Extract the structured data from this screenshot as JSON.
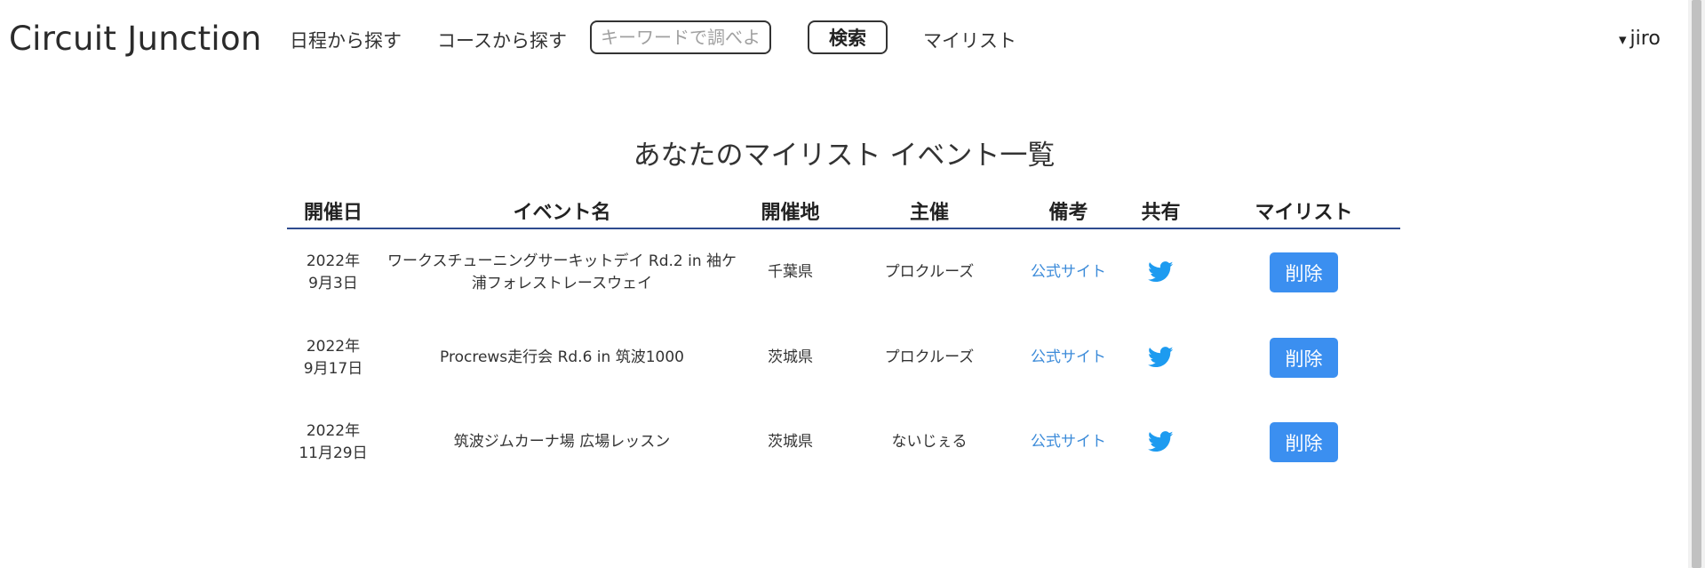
{
  "header": {
    "brand": "Circuit Junction",
    "nav_schedule": "日程から探す",
    "nav_course": "コースから探す",
    "search_placeholder": "キーワードで調べよう！",
    "search_button": "検索",
    "nav_mylist": "マイリスト",
    "user_caret": "▾",
    "user_name": "jiro"
  },
  "page": {
    "title": "あなたのマイリスト イベント一覧"
  },
  "table": {
    "columns": [
      "開催日",
      "イベント名",
      "開催地",
      "主催",
      "備考",
      "共有",
      "マイリスト"
    ],
    "rows": [
      {
        "date_year": "2022年",
        "date_day": "9月3日",
        "name": "ワークスチューニングサーキットデイ Rd.2 in 袖ケ浦フォレストレースウェイ",
        "location": "千葉県",
        "organizer": "プロクルーズ",
        "note_link": "公式サイト",
        "share_icon": "twitter-icon",
        "action": "削除"
      },
      {
        "date_year": "2022年",
        "date_day": "9月17日",
        "name": "Procrews走行会 Rd.6 in 筑波1000",
        "location": "茨城県",
        "organizer": "プロクルーズ",
        "note_link": "公式サイト",
        "share_icon": "twitter-icon",
        "action": "削除"
      },
      {
        "date_year": "2022年",
        "date_day": "11月29日",
        "name": "筑波ジムカーナ場 広場レッスン",
        "location": "茨城県",
        "organizer": "ないじぇる",
        "note_link": "公式サイト",
        "share_icon": "twitter-icon",
        "action": "削除"
      }
    ]
  },
  "colors": {
    "accent_button": "#3b8ff0",
    "link": "#3c8bd9",
    "twitter": "#1d9bf0",
    "table_rule": "#2f4b8f"
  }
}
